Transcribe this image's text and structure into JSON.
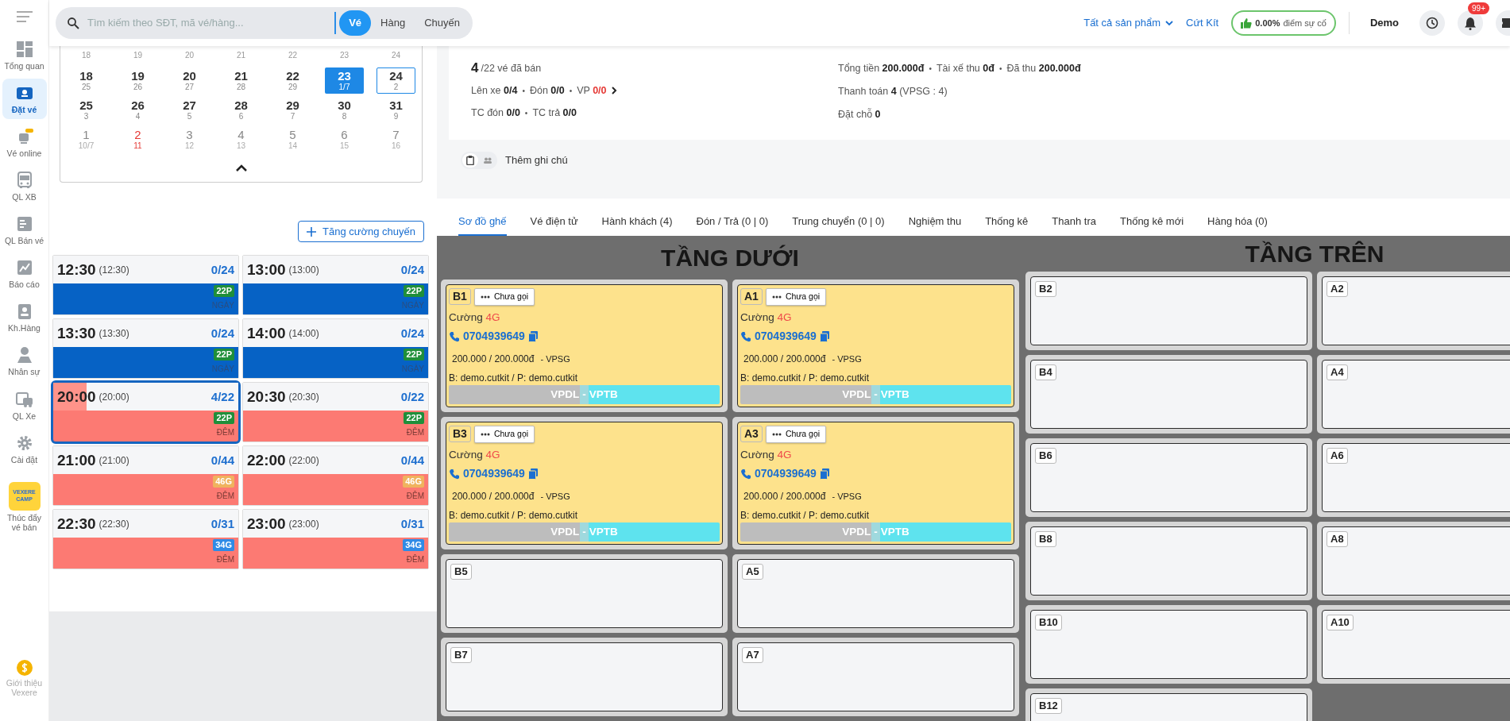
{
  "sidebar": {
    "items": [
      {
        "label": "Tổng quan",
        "selected": false
      },
      {
        "label": "Đặt vé",
        "selected": true
      },
      {
        "label": "Vé online",
        "selected": false
      },
      {
        "label": "QL XB",
        "selected": false
      },
      {
        "label": "QL Bán vé",
        "selected": false
      },
      {
        "label": "Báo cáo",
        "selected": false
      },
      {
        "label": "Kh.Hàng",
        "selected": false
      },
      {
        "label": "Nhân sự",
        "selected": false
      },
      {
        "label": "QL Xe",
        "selected": false
      },
      {
        "label": "Cài đặt",
        "selected": false
      }
    ],
    "promo": {
      "logo": "VEXERE CAMP",
      "label": "Thúc đẩy vé bán"
    },
    "footer": "Giới thiệu Vexere"
  },
  "search": {
    "placeholder": "Tìm kiếm theo SĐT, mã vé/hàng...",
    "modes": [
      {
        "label": "Vé",
        "selected": true
      },
      {
        "label": "Hàng",
        "selected": false
      },
      {
        "label": "Chuyến",
        "selected": false
      }
    ]
  },
  "header": {
    "products": "Tất cả sản phẩm",
    "account": "Cứt Kít",
    "incident": {
      "value": "0.00%",
      "label": "điểm sự cố"
    },
    "user": "Demo",
    "notifications": "99+"
  },
  "calendar": {
    "partial_row": [
      "18",
      "19",
      "20",
      "21",
      "22",
      "23",
      "24"
    ],
    "weeks": [
      [
        {
          "day": "18",
          "lunar": "25",
          "selected": false,
          "outlined": false,
          "other_month": false,
          "holiday": false
        },
        {
          "day": "19",
          "lunar": "26",
          "selected": false,
          "outlined": false,
          "other_month": false,
          "holiday": false
        },
        {
          "day": "20",
          "lunar": "27",
          "selected": false,
          "outlined": false,
          "other_month": false,
          "holiday": false
        },
        {
          "day": "21",
          "lunar": "28",
          "selected": false,
          "outlined": false,
          "other_month": false,
          "holiday": false
        },
        {
          "day": "22",
          "lunar": "29",
          "selected": false,
          "outlined": false,
          "other_month": false,
          "holiday": false
        },
        {
          "day": "23",
          "lunar": "1/7",
          "selected": true,
          "outlined": false,
          "other_month": false,
          "holiday": false
        },
        {
          "day": "24",
          "lunar": "2",
          "selected": false,
          "outlined": true,
          "other_month": false,
          "holiday": false
        }
      ],
      [
        {
          "day": "25",
          "lunar": "3",
          "selected": false,
          "outlined": false,
          "other_month": false,
          "holiday": false
        },
        {
          "day": "26",
          "lunar": "4",
          "selected": false,
          "outlined": false,
          "other_month": false,
          "holiday": false
        },
        {
          "day": "27",
          "lunar": "5",
          "selected": false,
          "outlined": false,
          "other_month": false,
          "holiday": false
        },
        {
          "day": "28",
          "lunar": "6",
          "selected": false,
          "outlined": false,
          "other_month": false,
          "holiday": false
        },
        {
          "day": "29",
          "lunar": "7",
          "selected": false,
          "outlined": false,
          "other_month": false,
          "holiday": false
        },
        {
          "day": "30",
          "lunar": "8",
          "selected": false,
          "outlined": false,
          "other_month": false,
          "holiday": false
        },
        {
          "day": "31",
          "lunar": "9",
          "selected": false,
          "outlined": false,
          "other_month": false,
          "holiday": false
        }
      ],
      [
        {
          "day": "1",
          "lunar": "10/7",
          "selected": false,
          "outlined": false,
          "other_month": true,
          "holiday": false
        },
        {
          "day": "2",
          "lunar": "11",
          "selected": false,
          "outlined": false,
          "other_month": true,
          "holiday": true
        },
        {
          "day": "3",
          "lunar": "12",
          "selected": false,
          "outlined": false,
          "other_month": true,
          "holiday": false
        },
        {
          "day": "4",
          "lunar": "13",
          "selected": false,
          "outlined": false,
          "other_month": true,
          "holiday": false
        },
        {
          "day": "5",
          "lunar": "14",
          "selected": false,
          "outlined": false,
          "other_month": true,
          "holiday": false
        },
        {
          "day": "6",
          "lunar": "15",
          "selected": false,
          "outlined": false,
          "other_month": true,
          "holiday": false
        },
        {
          "day": "7",
          "lunar": "16",
          "selected": false,
          "outlined": false,
          "other_month": true,
          "holiday": false
        }
      ]
    ]
  },
  "add_trip_button": "Tăng cường chuyến",
  "trips": [
    {
      "time": "12:30",
      "sub": "(12:30)",
      "seats": "0/24",
      "badge": {
        "text": "22P",
        "color": "#1f8f3a"
      },
      "period": "NGÀY",
      "kind": "day",
      "selected": false,
      "level": 0
    },
    {
      "time": "13:00",
      "sub": "(13:00)",
      "seats": "0/24",
      "badge": {
        "text": "22P",
        "color": "#1f8f3a"
      },
      "period": "NGÀY",
      "kind": "day",
      "selected": false,
      "level": 0
    },
    {
      "time": "13:30",
      "sub": "(13:30)",
      "seats": "0/24",
      "badge": {
        "text": "22P",
        "color": "#1f8f3a"
      },
      "period": "NGÀY",
      "kind": "day",
      "selected": false,
      "level": 0
    },
    {
      "time": "14:00",
      "sub": "(14:00)",
      "seats": "0/24",
      "badge": {
        "text": "22P",
        "color": "#1f8f3a"
      },
      "period": "NGÀY",
      "kind": "day",
      "selected": false,
      "level": 0
    },
    {
      "time": "20:00",
      "sub": "(20:00)",
      "seats": "4/22",
      "badge": {
        "text": "22P",
        "color": "#1f8f3a"
      },
      "period": "ĐÊM",
      "kind": "night",
      "selected": true,
      "level": 0.18
    },
    {
      "time": "20:30",
      "sub": "(20:30)",
      "seats": "0/22",
      "badge": {
        "text": "22P",
        "color": "#1f8f3a"
      },
      "period": "ĐÊM",
      "kind": "night",
      "selected": false,
      "level": 0
    },
    {
      "time": "21:00",
      "sub": "(21:00)",
      "seats": "0/44",
      "badge": {
        "text": "46G",
        "color": "#f0b35e"
      },
      "period": "ĐÊM",
      "kind": "night",
      "selected": false,
      "level": 0
    },
    {
      "time": "22:00",
      "sub": "(22:00)",
      "seats": "0/44",
      "badge": {
        "text": "46G",
        "color": "#f0b35e"
      },
      "period": "ĐÊM",
      "kind": "night",
      "selected": false,
      "level": 0
    },
    {
      "time": "22:30",
      "sub": "(22:30)",
      "seats": "0/31",
      "badge": {
        "text": "34G",
        "color": "#2f8be6"
      },
      "period": "ĐÊM",
      "kind": "night",
      "selected": false,
      "level": 0
    },
    {
      "time": "23:00",
      "sub": "(23:00)",
      "seats": "0/31",
      "badge": {
        "text": "34G",
        "color": "#2f8be6"
      },
      "period": "ĐÊM",
      "kind": "night",
      "selected": false,
      "level": 0
    }
  ],
  "summary": {
    "separator": "•",
    "sold": "4",
    "sold_label": "/22 vé đã bán",
    "left_lines": [
      [
        {
          "text": "Lên xe **0/4**",
          "alert": false,
          "more": false
        },
        {
          "text": "Đón **0/0**",
          "alert": false,
          "more": false
        },
        {
          "text": "VP **0/0**",
          "alert": true,
          "more": true
        }
      ],
      [
        {
          "text": "TC đón **0/0**",
          "alert": false,
          "more": false
        },
        {
          "text": "TC trả **0/0**",
          "alert": false,
          "more": false
        }
      ]
    ],
    "right_lines": [
      [
        {
          "text": "Tổng tiền **200.000đ**",
          "alert": false,
          "more": false
        },
        {
          "text": "Tài xế thu **0đ**",
          "alert": false,
          "more": false
        },
        {
          "text": "Đã thu **200.000đ**",
          "alert": false,
          "more": false
        }
      ],
      [
        {
          "text": "Thanh toán **4** (VPSG : 4)",
          "alert": false,
          "more": false
        }
      ],
      [
        {
          "text": "Đặt chỗ **0**",
          "alert": false,
          "more": false
        }
      ]
    ]
  },
  "note": {
    "label": "Thêm ghi chú",
    "modes": [
      {
        "selected": true
      },
      {
        "selected": false
      }
    ]
  },
  "tabs": [
    {
      "label": "Sơ đồ ghế",
      "selected": true
    },
    {
      "label": "Vé điện tử",
      "selected": false
    },
    {
      "label": "Hành khách (4)",
      "selected": false
    },
    {
      "label": "Đón / Trả (0 | 0)",
      "selected": false
    },
    {
      "label": "Trung chuyển (0 | 0)",
      "selected": false
    },
    {
      "label": "Nghiệm thu",
      "selected": false
    },
    {
      "label": "Thống kê",
      "selected": false
    },
    {
      "label": "Thanh tra",
      "selected": false
    },
    {
      "label": "Thống kê mới",
      "selected": false
    },
    {
      "label": "Hàng hóa (0)",
      "selected": false
    }
  ],
  "seat_map": {
    "decks": [
      {
        "title": "TẦNG DƯỚI",
        "rows": [
          [
            {
              "code": "B1",
              "kind": "booked",
              "call_status": "Chưa gọi",
              "name": "Cường",
              "tag": "4G",
              "phone": "0704939649",
              "price": "200.000 / 200.000đ",
              "office": "- VPSG",
              "staff": "B: demo.cutkit / P: demo.cutkit",
              "route": {
                "from": "VPDL",
                "sep": "-",
                "to": "VPTB"
              }
            },
            {
              "code": "A1",
              "kind": "booked",
              "call_status": "Chưa gọi",
              "name": "Cường",
              "tag": "4G",
              "phone": "0704939649",
              "price": "200.000 / 200.000đ",
              "office": "- VPSG",
              "staff": "B: demo.cutkit / P: demo.cutkit",
              "route": {
                "from": "VPDL",
                "sep": "-",
                "to": "VPTB"
              }
            }
          ],
          [
            {
              "code": "B3",
              "kind": "booked",
              "call_status": "Chưa gọi",
              "name": "Cường",
              "tag": "4G",
              "phone": "0704939649",
              "price": "200.000 / 200.000đ",
              "office": "- VPSG",
              "staff": "B: demo.cutkit / P: demo.cutkit",
              "route": {
                "from": "VPDL",
                "sep": "-",
                "to": "VPTB"
              }
            },
            {
              "code": "A3",
              "kind": "booked",
              "call_status": "Chưa gọi",
              "name": "Cường",
              "tag": "4G",
              "phone": "0704939649",
              "price": "200.000 / 200.000đ",
              "office": "- VPSG",
              "staff": "B: demo.cutkit / P: demo.cutkit",
              "route": {
                "from": "VPDL",
                "sep": "-",
                "to": "VPTB"
              }
            }
          ],
          [
            {
              "code": "B5",
              "kind": "empty"
            },
            {
              "code": "A5",
              "kind": "empty"
            }
          ],
          [
            {
              "code": "B7",
              "kind": "empty"
            },
            {
              "code": "A7",
              "kind": "empty"
            }
          ]
        ]
      },
      {
        "title": "TẦNG TRÊN",
        "rows": [
          [
            {
              "code": "B2",
              "kind": "empty"
            },
            {
              "code": "A2",
              "kind": "empty"
            }
          ],
          [
            {
              "code": "B4",
              "kind": "empty"
            },
            {
              "code": "A4",
              "kind": "empty"
            }
          ],
          [
            {
              "code": "B6",
              "kind": "empty"
            },
            {
              "code": "A6",
              "kind": "empty"
            }
          ],
          [
            {
              "code": "B8",
              "kind": "empty"
            },
            {
              "code": "A8",
              "kind": "empty"
            }
          ],
          [
            {
              "code": "B10",
              "kind": "empty"
            },
            {
              "code": "A10",
              "kind": "empty"
            }
          ],
          [
            {
              "code": "B12",
              "kind": "empty"
            }
          ]
        ]
      }
    ]
  }
}
